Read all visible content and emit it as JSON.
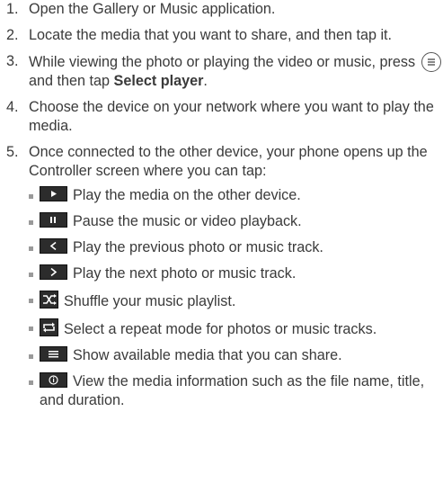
{
  "steps": [
    {
      "num": "1.",
      "text": "Open the Gallery or Music application."
    },
    {
      "num": "2.",
      "text": "Locate the media that you want to share, and then tap it."
    },
    {
      "num": "3.",
      "text_before": "While viewing the photo or playing the video or music, press ",
      "text_middle": " and then tap ",
      "bold": "Select player",
      "text_after": "."
    },
    {
      "num": "4.",
      "text": "Choose the device on your network where you want to play the media."
    },
    {
      "num": "5.",
      "text": "Once connected to the other device, your phone opens up the Controller screen where you can tap:"
    }
  ],
  "controls": [
    {
      "icon": "play-icon",
      "text": "Play the media on the other device."
    },
    {
      "icon": "pause-icon",
      "text": "Pause the music or video playback."
    },
    {
      "icon": "previous-icon",
      "text": "Play the previous photo or music track."
    },
    {
      "icon": "next-icon",
      "text": "Play the next photo or music track."
    },
    {
      "icon": "shuffle-icon",
      "text": "Shuffle your music playlist."
    },
    {
      "icon": "repeat-icon",
      "text": "Select a repeat mode for photos or music tracks."
    },
    {
      "icon": "list-icon",
      "text": "Show available media that you can share."
    },
    {
      "icon": "info-icon",
      "text": "View the media information such as the file name, title, and duration."
    }
  ]
}
